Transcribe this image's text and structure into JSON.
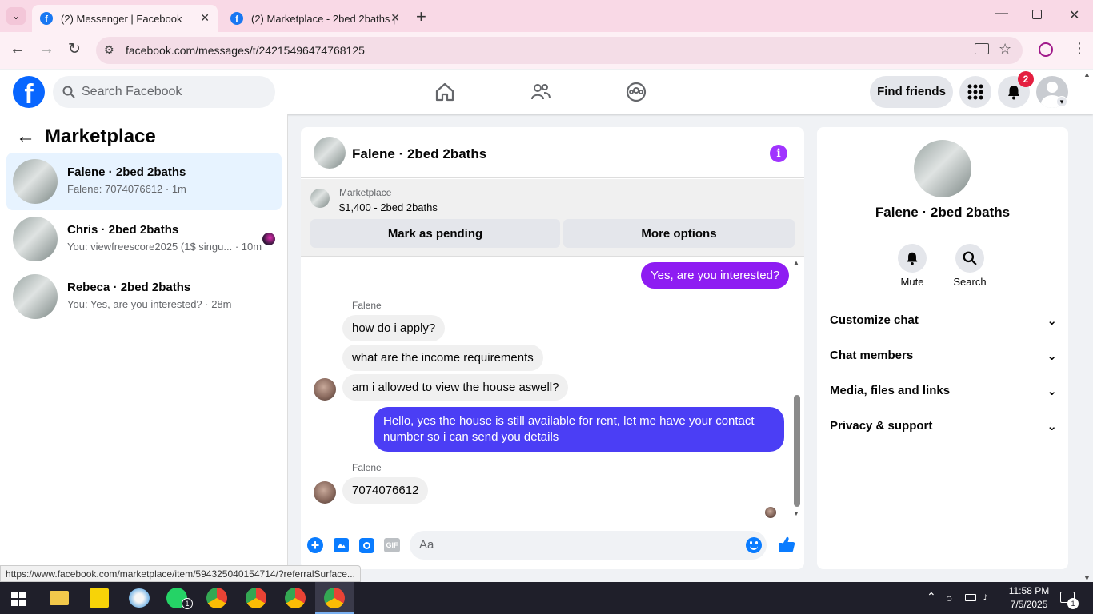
{
  "browser": {
    "tabs": [
      {
        "title": "(2) Messenger | Facebook",
        "active": true
      },
      {
        "title": "(2) Marketplace - 2bed 2baths |",
        "active": false
      }
    ],
    "url": "facebook.com/messages/t/24215496474768125",
    "status_url": "https://www.facebook.com/marketplace/item/594325040154714/?referralSurface..."
  },
  "fb_header": {
    "search_placeholder": "Search Facebook",
    "find_friends": "Find friends",
    "notifications_count": "2"
  },
  "sidebar": {
    "title": "Marketplace",
    "conversations": [
      {
        "title": "Falene · 2bed 2baths",
        "subtitle": "Falene: 7074076612 · 1m",
        "active": true
      },
      {
        "title": "Chris · 2bed 2baths",
        "subtitle": "You: viewfreescore2025 (1$ singu... · 10m",
        "active": false
      },
      {
        "title": "Rebeca · 2bed 2baths",
        "subtitle": "You: Yes, are you interested? · 28m",
        "active": false
      }
    ]
  },
  "chat": {
    "title": "Falene · 2bed 2baths",
    "listing_label": "Marketplace",
    "listing_price": "$1,400 - 2bed 2baths",
    "mark_pending": "Mark as pending",
    "more_options": "More options",
    "messages": [
      {
        "text": "Yes, are you interested?",
        "from": "me"
      },
      {
        "sender": "Falene"
      },
      {
        "text": "how do i apply?",
        "from": "them"
      },
      {
        "text": "what are the income requirements",
        "from": "them"
      },
      {
        "text": "am i allowed to view the house aswell?",
        "from": "them"
      },
      {
        "text": "Hello, yes the house is still available for rent, let me have your contact number so i can send you  details",
        "from": "me"
      },
      {
        "sender": "Falene"
      },
      {
        "text": "7074076612",
        "from": "them"
      }
    ],
    "input_placeholder": "Aa",
    "colors": {
      "accent": "#a033ff",
      "bubble_purple": "#8e1cf2",
      "bubble_blue": "#4b3ef5",
      "link_blue": "#0a7cff"
    }
  },
  "right_panel": {
    "name": "Falene · 2bed 2baths",
    "mute": "Mute",
    "search": "Search",
    "sections": [
      "Customize chat",
      "Chat members",
      "Media, files and links",
      "Privacy & support"
    ]
  },
  "taskbar": {
    "time": "11:58 PM",
    "date": "7/5/2025",
    "whatsapp_badge": "1",
    "notification_badge": "1"
  }
}
